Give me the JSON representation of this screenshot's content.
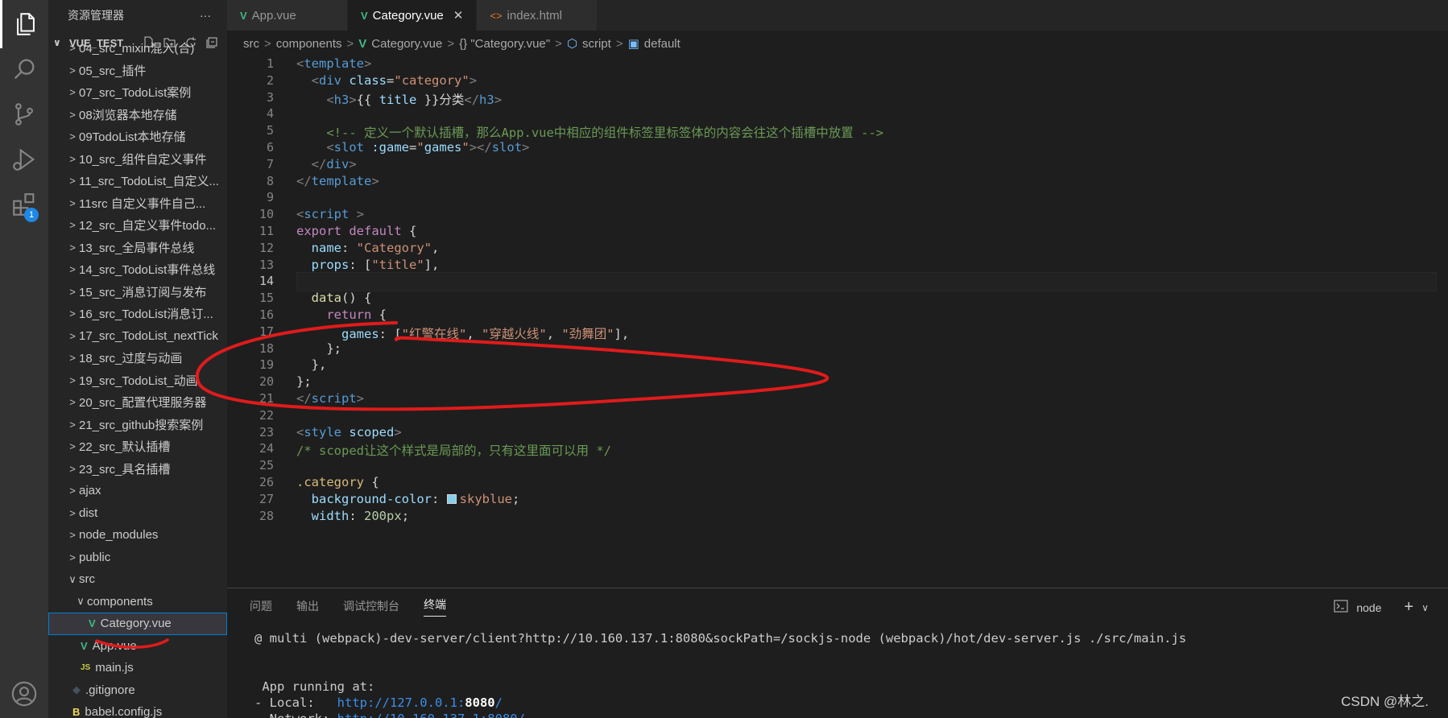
{
  "sidebar": {
    "title": "资源管理器",
    "more": "···",
    "project": "VUE_TEST",
    "items": [
      {
        "label": "04_src_mixin混入(合)",
        "indent": 0,
        "chev": ">"
      },
      {
        "label": "05_src_插件",
        "indent": 0,
        "chev": ">"
      },
      {
        "label": "07_src_TodoList案例",
        "indent": 0,
        "chev": ">"
      },
      {
        "label": "08浏览器本地存储",
        "indent": 0,
        "chev": ">"
      },
      {
        "label": "09TodoList本地存储",
        "indent": 0,
        "chev": ">"
      },
      {
        "label": "10_src_组件自定义事件",
        "indent": 0,
        "chev": ">"
      },
      {
        "label": "11_src_TodoList_自定义...",
        "indent": 0,
        "chev": ">"
      },
      {
        "label": "11src 自定义事件自己...",
        "indent": 0,
        "chev": ">"
      },
      {
        "label": "12_src_自定义事件todo...",
        "indent": 0,
        "chev": ">"
      },
      {
        "label": "13_src_全局事件总线",
        "indent": 0,
        "chev": ">"
      },
      {
        "label": "14_src_TodoList事件总线",
        "indent": 0,
        "chev": ">"
      },
      {
        "label": "15_src_消息订阅与发布",
        "indent": 0,
        "chev": ">"
      },
      {
        "label": "16_src_TodoList消息订...",
        "indent": 0,
        "chev": ">"
      },
      {
        "label": "17_src_TodoList_nextTick",
        "indent": 0,
        "chev": ">"
      },
      {
        "label": "18_src_过度与动画",
        "indent": 0,
        "chev": ">"
      },
      {
        "label": "19_src_TodoList_动画",
        "indent": 0,
        "chev": ">"
      },
      {
        "label": "20_src_配置代理服务器",
        "indent": 0,
        "chev": ">"
      },
      {
        "label": "21_src_github搜索案例",
        "indent": 0,
        "chev": ">"
      },
      {
        "label": "22_src_默认插槽",
        "indent": 0,
        "chev": ">"
      },
      {
        "label": "23_src_具名插槽",
        "indent": 0,
        "chev": ">"
      },
      {
        "label": "ajax",
        "indent": 0,
        "chev": ">"
      },
      {
        "label": "dist",
        "indent": 0,
        "chev": ">"
      },
      {
        "label": "node_modules",
        "indent": 0,
        "chev": ">"
      },
      {
        "label": "public",
        "indent": 0,
        "chev": ">"
      },
      {
        "label": "src",
        "indent": 0,
        "chev": "∨"
      },
      {
        "label": "components",
        "indent": 1,
        "chev": "∨"
      },
      {
        "label": "Category.vue",
        "indent": 2,
        "chev": "",
        "icon": "V",
        "selected": true
      },
      {
        "label": "App.vue",
        "indent": 1,
        "chev": "",
        "icon": "V"
      },
      {
        "label": "main.js",
        "indent": 1,
        "chev": "",
        "icon": "JS"
      },
      {
        "label": ".gitignore",
        "indent": 0,
        "chev": "",
        "icon": "◆"
      },
      {
        "label": "babel.config.js",
        "indent": 0,
        "chev": "",
        "icon": "B"
      }
    ]
  },
  "tabs": [
    {
      "label": "App.vue",
      "icon": "V",
      "active": false
    },
    {
      "label": "Category.vue",
      "icon": "V",
      "active": true,
      "close": "✕"
    },
    {
      "label": "index.html",
      "icon": "<>",
      "active": false
    }
  ],
  "breadcrumb": [
    "src",
    "components",
    "Category.vue",
    "{} \"Category.vue\"",
    "script",
    "default"
  ],
  "code": {
    "current_line": 14,
    "lines": [
      "<span class=\"p\">&lt;</span><span class=\"t\">template</span><span class=\"p\">&gt;</span>",
      "  <span class=\"p\">&lt;</span><span class=\"t\">div</span> <span class=\"a\">class</span><span class=\"w\">=</span><span class=\"s\">\"category\"</span><span class=\"p\">&gt;</span>",
      "    <span class=\"p\">&lt;</span><span class=\"t\">h3</span><span class=\"p\">&gt;</span><span class=\"w\">{{ </span><span class=\"a\">title</span><span class=\"w\"> }}分类</span><span class=\"p\">&lt;/</span><span class=\"t\">h3</span><span class=\"p\">&gt;</span>",
      "",
      "    <span class=\"c\">&lt;!-- 定义一个默认插槽，那么App.vue中相应的组件标签里标签体的内容会往这个插槽中放置 --&gt;</span>",
      "    <span class=\"p\">&lt;</span><span class=\"t\">slot</span> <span class=\"a\">:game</span><span class=\"w\">=</span><span class=\"s\">\"</span><span class=\"a\">games</span><span class=\"s\">\"</span><span class=\"p\">&gt;&lt;/</span><span class=\"t\">slot</span><span class=\"p\">&gt;</span>",
      "  <span class=\"p\">&lt;/</span><span class=\"t\">div</span><span class=\"p\">&gt;</span>",
      "<span class=\"p\">&lt;/</span><span class=\"t\">template</span><span class=\"p\">&gt;</span>",
      "",
      "<span class=\"p\">&lt;</span><span class=\"t\">script</span> <span class=\"p\">&gt;</span>",
      "<span class=\"k\">export</span> <span class=\"k\">default</span> <span class=\"w\">{</span>",
      "  <span class=\"a\">name</span><span class=\"w\">: </span><span class=\"s\">\"Category\"</span><span class=\"w\">,</span>",
      "  <span class=\"a\">props</span><span class=\"w\">: [</span><span class=\"s\">\"title\"</span><span class=\"w\">],</span>",
      "",
      "  <span class=\"f\">data</span><span class=\"w\">() {</span>",
      "    <span class=\"k\">return</span> <span class=\"w\">{</span>",
      "      <span class=\"a\">games</span><span class=\"w\">: [</span><span class=\"s\">\"红警在线\"</span><span class=\"w\">, </span><span class=\"s\">\"穿越火线\"</span><span class=\"w\">, </span><span class=\"s\">\"劲舞团\"</span><span class=\"w\">],</span>",
      "    <span class=\"w\">};</span>",
      "  <span class=\"w\">},</span>",
      "<span class=\"w\">};</span>",
      "<span class=\"p\">&lt;/</span><span class=\"t\">script</span><span class=\"p\">&gt;</span>",
      "",
      "<span class=\"p\">&lt;</span><span class=\"t\">style</span> <span class=\"a\">scoped</span><span class=\"p\">&gt;</span>",
      "<span class=\"c\">/* scoped让这个样式是局部的，只有这里面可以用 */</span>",
      "",
      "<span class=\"sel\">.category</span> <span class=\"w\">{</span>",
      "  <span class=\"a\">background-color</span><span class=\"w\">: </span><span class=\"sw\"></span><span class=\"s\">skyblue</span><span class=\"w\">;</span>",
      "  <span class=\"a\">width</span><span class=\"w\">: </span><span class=\"n\">200px</span><span class=\"w\">;</span>"
    ]
  },
  "panel": {
    "tabs": [
      "问题",
      "输出",
      "调试控制台",
      "终端"
    ],
    "active_tab": 3,
    "terminal_name": "node",
    "terminal_lines": [
      "@ multi (webpack)-dev-server/client?http://10.160.137.1:8080&sockPath=/sockjs-node (webpack)/hot/dev-server.js ./src/main.js",
      "",
      "",
      " App running at:",
      "<span>- Local:   </span><span class=\"url\">http://127.0.0.1:<span class=\"port\">8080</span>/</span>",
      "<span>- Network: </span><span class=\"url\">http://10.160.137.1:8080/</span>"
    ]
  },
  "watermark": "CSDN @林之.",
  "colors": {
    "accent": "#007fd4",
    "vue": "#41b883",
    "annotation": "#e01b1b"
  }
}
